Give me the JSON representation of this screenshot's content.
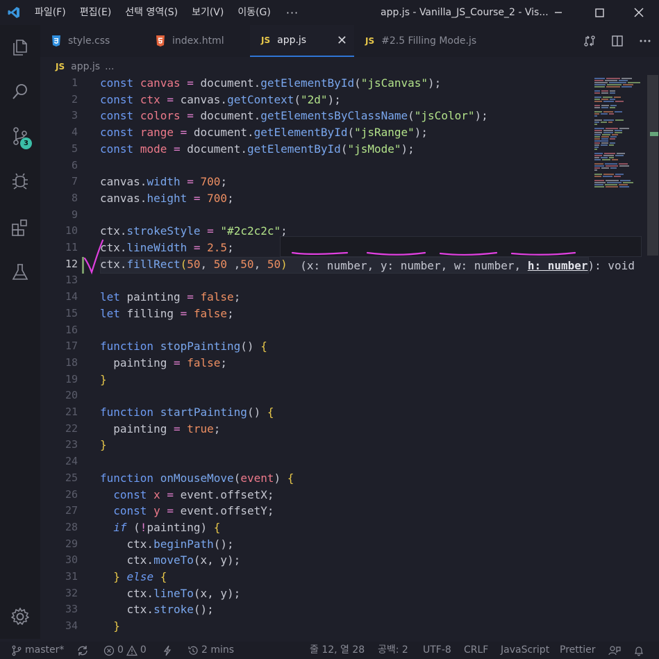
{
  "menu": [
    "파일(F)",
    "편집(E)",
    "선택 영역(S)",
    "보기(V)",
    "이동(G)"
  ],
  "menu_more": "···",
  "window_title": "app.js - Vanilla_JS_Course_2 - Vis...",
  "source_control_badge": "3",
  "tabs": [
    {
      "label": "style.css",
      "icon": "css3-icon"
    },
    {
      "label": "index.html",
      "icon": "html5-icon"
    },
    {
      "label": "app.js",
      "icon": "JS",
      "active": true
    },
    {
      "label": "#2.5 Filling Mode.js",
      "icon": "JS"
    }
  ],
  "breadcrumb": {
    "file": "app.js",
    "rest": "..."
  },
  "editor": {
    "line_numbers": [
      "1",
      "2",
      "3",
      "4",
      "5",
      "6",
      "7",
      "8",
      "9",
      "10",
      "11",
      "12",
      "13",
      "14",
      "15",
      "16",
      "17",
      "18",
      "19",
      "20",
      "21",
      "22",
      "23",
      "24",
      "25",
      "26",
      "27",
      "28",
      "29",
      "30",
      "31",
      "32",
      "33",
      "34"
    ],
    "current_line": 12
  },
  "hint": {
    "open": "(",
    "params": [
      "x: number",
      "y: number",
      "w: number",
      "h: number"
    ],
    "sep": ", ",
    "close": "): void",
    "active_param": 3
  },
  "status": {
    "branch": "master*",
    "errors": "0",
    "warnings": "0",
    "time": "2 mins",
    "position": "줄 12, 열 28",
    "spaces": "공백: 2",
    "encoding": "UTF-8",
    "eol": "CRLF",
    "language": "JavaScript",
    "formatter": "Prettier"
  },
  "colors": {
    "keyword": "#6d9bf3",
    "variable": "#ee7a8b",
    "string": "#b3e38a",
    "number": "#ee8f62",
    "active_tab_border": "#2f76d6",
    "badge": "#3bbfa8",
    "annotation": "#e040e0"
  }
}
